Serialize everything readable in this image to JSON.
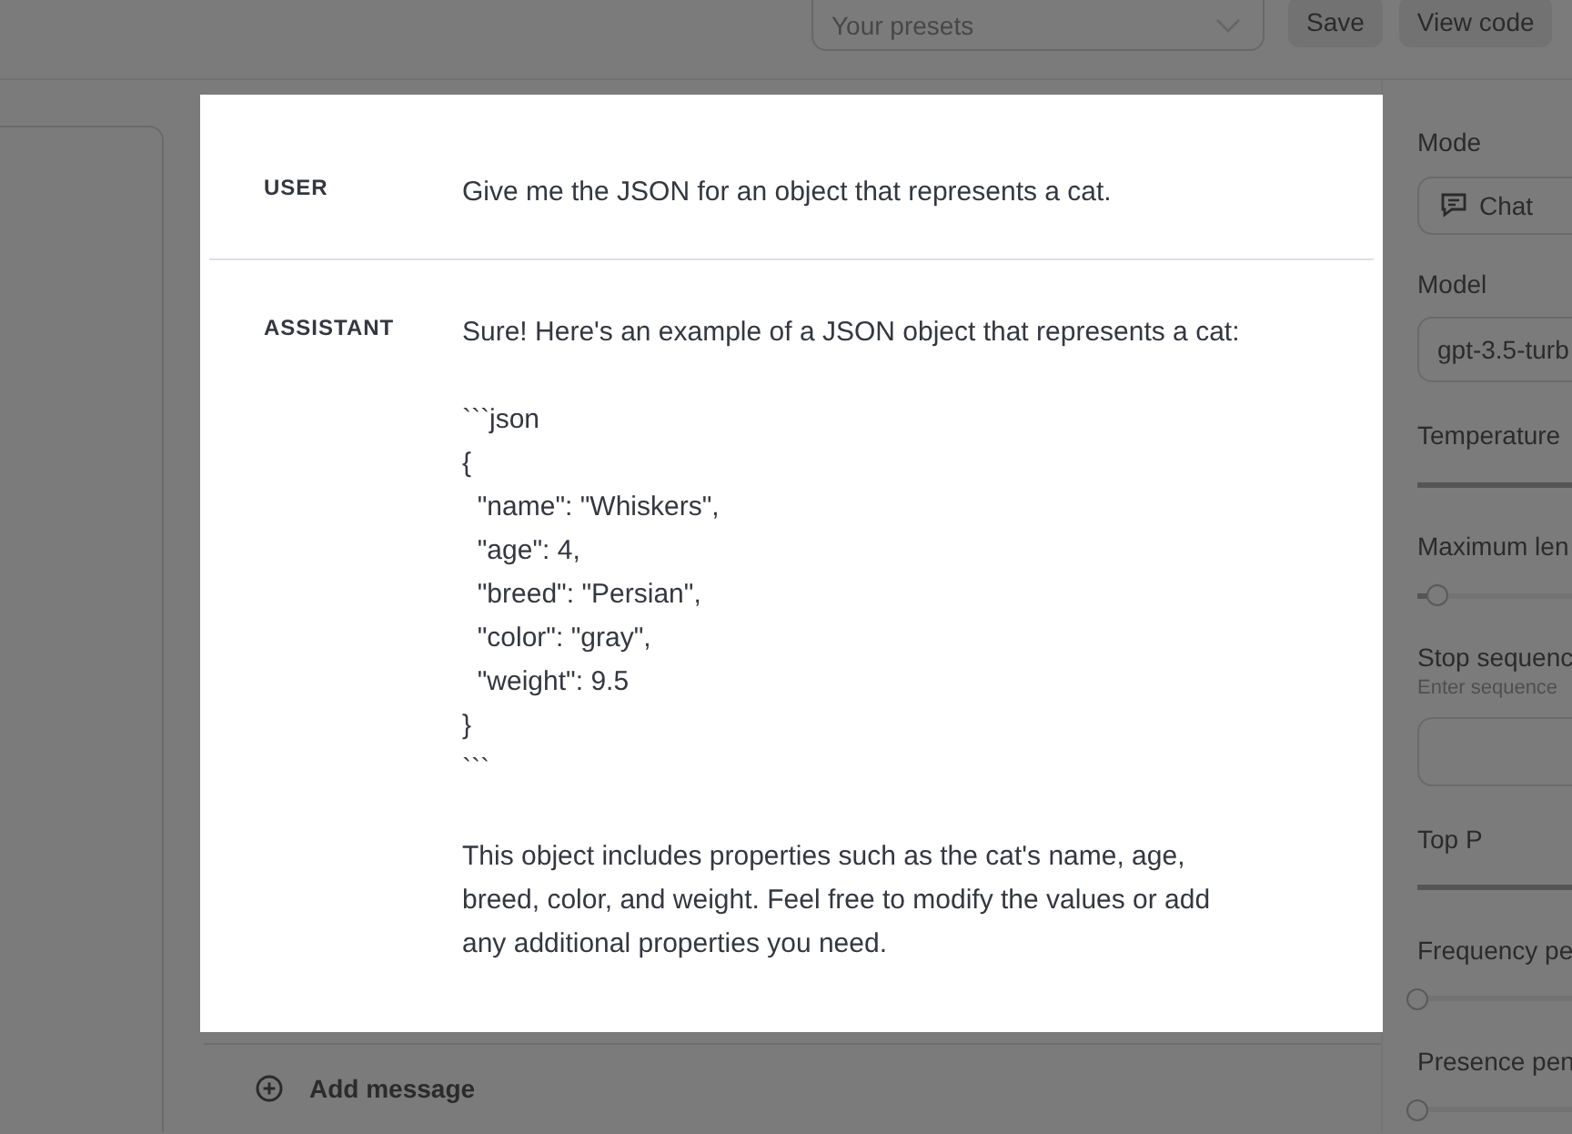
{
  "toolbar": {
    "presets": {
      "placeholder": "Your presets"
    },
    "buttons": [
      "Save",
      "View code"
    ]
  },
  "messages": [
    {
      "role": "USER",
      "content": "Give me the JSON for an object that represents a cat."
    },
    {
      "role": "ASSISTANT",
      "content": "Sure! Here's an example of a JSON object that represents a cat:\n\n```json\n{\n  \"name\": \"Whiskers\",\n  \"age\": 4,\n  \"breed\": \"Persian\",\n  \"color\": \"gray\",\n  \"weight\": 9.5\n}\n```\n\nThis object includes properties such as the cat's name, age, breed, color, and weight. Feel free to modify the values or add any additional properties you need."
    }
  ],
  "add_message": "Add message",
  "settings": [
    {
      "kind": "select",
      "label": "Mode",
      "value": "Chat"
    },
    {
      "kind": "select",
      "label": "Model",
      "value": "gpt-3.5-turb"
    },
    {
      "kind": "slider",
      "label": "Temperature"
    },
    {
      "kind": "slider",
      "label": "Maximum len",
      "level": 0.04
    },
    {
      "kind": "textarea",
      "label": "Stop sequenc",
      "hint": "Enter sequence"
    },
    {
      "kind": "slider",
      "label": "Top P"
    },
    {
      "kind": "slider",
      "label": "Frequency pe",
      "level": 0
    },
    {
      "kind": "slider",
      "label": "Presence pen",
      "level": 0
    }
  ]
}
